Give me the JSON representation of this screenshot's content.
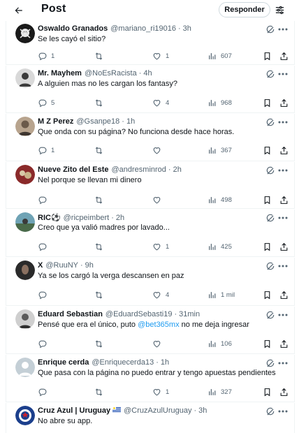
{
  "header": {
    "title": "Post",
    "reply_button": "Responder"
  },
  "tweets": [
    {
      "name": "Oswaldo Granados",
      "handle": "@mariano_ri19016",
      "time": "3h",
      "text": "Se les cayó el sitio?",
      "replies": "1",
      "retweets": "",
      "likes": "1",
      "views": "607",
      "avatar_color": "#1a1a1a"
    },
    {
      "name": "Mr. Mayhem",
      "handle": "@NoEsRacista",
      "time": "4h",
      "text": "A alguien mas no les cargan los fantasy?",
      "replies": "5",
      "retweets": "",
      "likes": "4",
      "views": "968",
      "avatar_color": "#3b3b3b"
    },
    {
      "name": "M Z Perez",
      "handle": "@Gsanpe18",
      "time": "1h",
      "text": "Que onda con su página? No funciona desde hace horas.",
      "replies": "1",
      "retweets": "",
      "likes": "",
      "views": "367",
      "avatar_color": "#6b5a4a"
    },
    {
      "name": "Nueve Zito del Este",
      "handle": "@andresminrod",
      "time": "2h",
      "text": "Nel porque se llevan mi dinero",
      "replies": "",
      "retweets": "",
      "likes": "",
      "views": "498",
      "avatar_color": "#8a2a2a"
    },
    {
      "name": "RIC⚽",
      "handle": "@ricpeimbert",
      "time": "2h",
      "text": "Creo que ya valió madres por lavado...",
      "replies": "",
      "retweets": "",
      "likes": "1",
      "views": "425",
      "avatar_color": "#4a7a8a"
    },
    {
      "name": "X",
      "handle": "@RuuNY",
      "time": "9h",
      "text": "Ya se los cargó la verga descansen en paz",
      "replies": "",
      "retweets": "",
      "likes": "4",
      "views": "1 mil",
      "avatar_color": "#2a2a2a"
    },
    {
      "name": "Eduard Sebastian",
      "handle": "@EduardSebasti19",
      "time": "31min",
      "text_before": "Pensé que era el único, puto ",
      "mention": "@bet365mx",
      "text_after": " no me deja ingresar",
      "replies": "",
      "retweets": "",
      "likes": "",
      "views": "106",
      "avatar_color": "#5a5a5a"
    },
    {
      "name": "Enrique cerda",
      "handle": "@Enriquecerda13",
      "time": "1h",
      "text": "Que pasa con la página no puedo entrar y tengo apuestas pendientes",
      "replies": "",
      "retweets": "",
      "likes": "1",
      "views": "327",
      "avatar_color": "#c4cfd6"
    },
    {
      "name": "Cruz Azul | Uruguay",
      "handle": "@CruzAzulUruguay",
      "time": "3h",
      "text": "No abre su app.",
      "avatar_color": "#1b3f8c"
    }
  ],
  "colors": {
    "accent": "#1d9bf0",
    "muted": "#536471",
    "border": "#eff3f4"
  }
}
